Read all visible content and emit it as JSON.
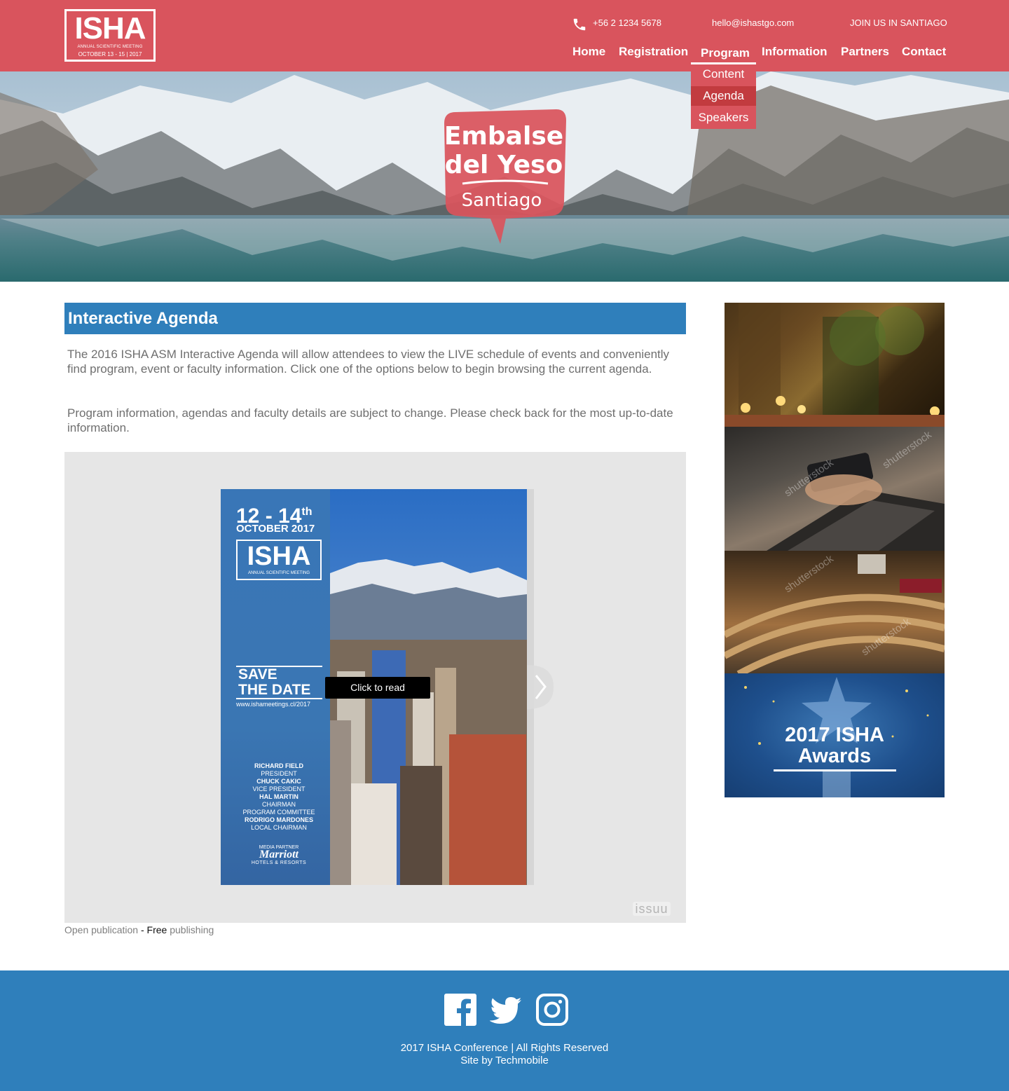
{
  "header": {
    "logo": {
      "main": "ISHA",
      "sub": "ANNUAL SCIENTIFIC MEETING",
      "date": "OCTOBER 13 - 15 | 2017"
    },
    "phone": "+56 2 1234 5678",
    "email": "hello@ishastgo.com",
    "join": "JOIN US IN SANTIAGO",
    "nav": [
      "Home",
      "Registration",
      "Program",
      "Information",
      "Partners",
      "Contact"
    ],
    "active_nav": "Program",
    "dropdown": [
      "Content",
      "Agenda",
      "Speakers"
    ],
    "active_dropdown": "Agenda",
    "colors": {
      "bar": "#d9545d",
      "dropdown_active": "#c23b3f"
    }
  },
  "hero": {
    "badge_line1": "Embalse",
    "badge_line2": "del Yeso",
    "badge_line3": "Santiago"
  },
  "main": {
    "title": "Interactive Agenda",
    "paragraph1": "The 2016 ISHA ASM Interactive Agenda will allow attendees to view the LIVE schedule of events and conveniently find program, event or faculty information. Click one of the options below to begin browsing the current agenda.",
    "paragraph2": "Program information, agendas and faculty details are subject to change. Please check back for the most up-to-date information.",
    "accent": "#2f7fbb"
  },
  "publication": {
    "dates": "12 - 14",
    "dates_sup": "th",
    "month": "OCTOBER 2017",
    "logo_main": "ISHA",
    "logo_sub": "ANNUAL SCIENTIFIC MEETING",
    "save_line1": "SAVE",
    "save_line2": "THE DATE",
    "url": "www.ishameetings.cl/2017",
    "people": [
      {
        "name": "RICHARD FIELD",
        "role": "PRESIDENT"
      },
      {
        "name": "CHUCK CAKIC",
        "role": "VICE PRESIDENT"
      },
      {
        "name": "HAL MARTIN",
        "role": "CHAIRMAN\nPROGRAM COMMITTEE"
      },
      {
        "name": "RODRIGO MARDONES",
        "role": "LOCAL CHAIRMAN"
      }
    ],
    "media_partner": "MEDIA PARTNER",
    "marriott": "Marriott",
    "hotels": "HOTELS & RESORTS",
    "click_to_read": "Click to read",
    "issuu": "issuu",
    "next_icon": "chevron-right-icon"
  },
  "open_publication": {
    "link": "Open publication",
    "sep": " - ",
    "free": "Free",
    "publishing": " publishing"
  },
  "sidebar": {
    "awards_line1": "2017 ISHA",
    "awards_line2": "Awards",
    "watermark": "shutterstock"
  },
  "footer": {
    "icons": [
      "facebook-icon",
      "twitter-icon",
      "instagram-icon"
    ],
    "copyright": "2017 ISHA Conference | All Rights Reserved",
    "credit": "Site by Techmobile",
    "color": "#2f7fbb"
  }
}
